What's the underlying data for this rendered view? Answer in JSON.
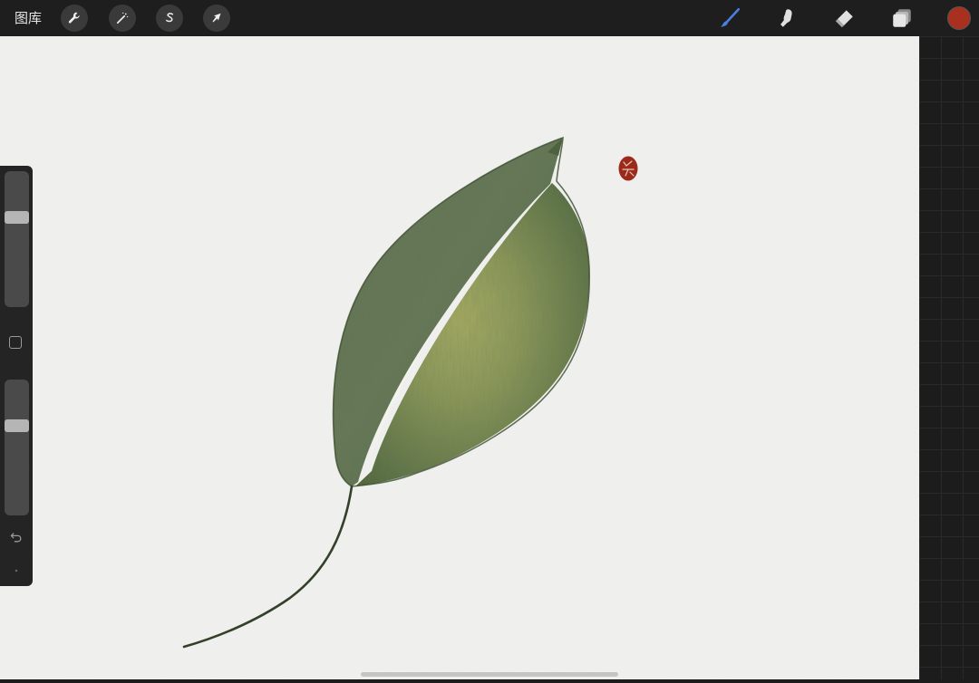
{
  "toolbar": {
    "gallery_label": "图库",
    "actions": [
      {
        "name": "actions-button",
        "icon": "wrench-icon"
      },
      {
        "name": "adjustments-button",
        "icon": "magic-wand-icon"
      },
      {
        "name": "selection-button",
        "icon": "selection-s-icon"
      },
      {
        "name": "transform-button",
        "icon": "arrow-cursor-icon"
      }
    ],
    "tools": [
      {
        "name": "brush-tool-button",
        "icon": "brush-icon",
        "active": true
      },
      {
        "name": "smudge-tool-button",
        "icon": "smudge-finger-icon",
        "active": false
      },
      {
        "name": "eraser-tool-button",
        "icon": "eraser-icon",
        "active": false
      },
      {
        "name": "layers-button",
        "icon": "layers-icon",
        "active": false
      }
    ],
    "current_color": "#a9301f"
  },
  "sidebar": {
    "brush_size_level": 0.68,
    "opacity_level": 0.68
  },
  "colors": {
    "toolbar_bg": "#1e1e1e",
    "paper": "#f1f1ef",
    "leaf_dark": "#4b5e3c",
    "leaf_light": "#93a057",
    "stamp_red": "#9b2a1b",
    "active_tool_blue": "#4a7fe0"
  }
}
